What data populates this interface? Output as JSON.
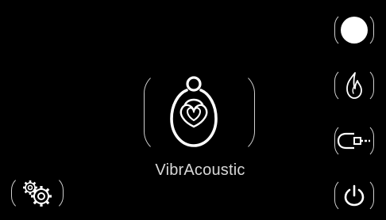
{
  "app": {
    "title": "VibrAcoustic"
  },
  "colors": {
    "background": "#000000",
    "line": "#cfcfcf",
    "icon": "#ffffff",
    "text": "#d8d8d8"
  },
  "buttons": {
    "circle": {
      "icon": "solid-circle-icon"
    },
    "flame": {
      "icon": "flame-icon"
    },
    "cable": {
      "icon": "audio-plug-icon"
    },
    "power": {
      "icon": "power-icon"
    },
    "settings": {
      "icon": "gears-icon"
    }
  }
}
